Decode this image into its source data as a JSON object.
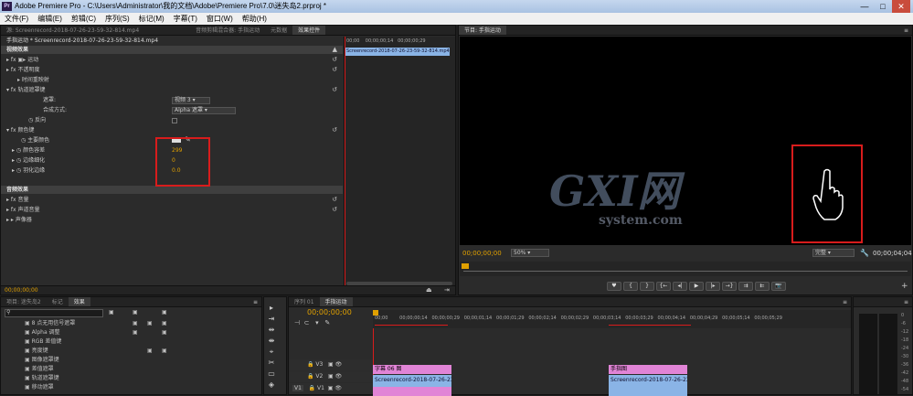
{
  "window": {
    "title": "Adobe Premiere Pro - C:\\Users\\Administrator\\我的文档\\Adobe\\Premiere Pro\\7.0\\迷失岛2.prproj *",
    "min": "—",
    "max": "□",
    "close": "✕"
  },
  "menu": [
    "文件(F)",
    "编辑(E)",
    "剪辑(C)",
    "序列(S)",
    "标记(M)",
    "字幕(T)",
    "窗口(W)",
    "帮助(H)"
  ],
  "source_tabs": [
    "源: Screenrecord-2018-07-26-23-59-32-814.mp4",
    "音频剪辑混合器: 手指运动",
    "元数据",
    "效果控件"
  ],
  "effect_controls": {
    "clip_label": "手指运动 * Screenrecord-2018-07-26-23-59-32-814.mp4",
    "timeline_ticks": [
      "00;00",
      "00;00;00;14",
      "00;00;00;29"
    ],
    "clip_name": "Screenrecord-2018-07-26-23-59-32-814.mp4",
    "video_effects_header": "视频效果",
    "motion": "fx ▣▸ 运动",
    "opacity": "fx 不透明度",
    "time_remap": "时间重映射",
    "track_matte": "fx 轨道遮罩键",
    "matte_label": "遮罩:",
    "matte_value": "视频 3",
    "composite_label": "合成方式:",
    "composite_value": "Alpha 遮罩",
    "reverse_label": "反向",
    "color_key": "fx 颜色键",
    "key_color_label": "主要颜色",
    "tolerance_label": "颜色容差",
    "tolerance_value": "299",
    "edge_thin_label": "边缘细化",
    "edge_thin_value": "0",
    "feather_label": "羽化边缘",
    "feather_value": "0.0",
    "audio_effects_header": "音频效果",
    "volume": "fx 音量",
    "channel_volume": "fx 声道音量",
    "panner": "声像器",
    "timecode": "00;00;00;00"
  },
  "program": {
    "tab": "节目: 手指运动",
    "timecode": "00;00;00;00",
    "zoom": "50%",
    "quality": "完整",
    "duration": "00;00;04;04",
    "watermark_main": "GXI网",
    "watermark_sub": "system.com"
  },
  "transport": [
    "♥",
    "{",
    "}",
    "{←",
    "◂|",
    "▶",
    "|▸",
    "→}",
    "⇉",
    "⇇",
    "📷"
  ],
  "project": {
    "tabs": [
      "项目: 迷失岛2",
      "标记",
      "效果"
    ],
    "search_placeholder": "",
    "effects": [
      "8 点无用信号遮罩",
      "Alpha 调整",
      "RGB 差值键",
      "亮度键",
      "图像遮罩键",
      "差值遮罩",
      "移除遮罩"
    ],
    "effects_more": [
      "轨道遮罩键",
      "移动遮罩"
    ]
  },
  "tools": [
    "▸",
    "⇥",
    "⇹",
    "⇼",
    "⌖",
    "◈",
    "✂",
    "▭",
    "✋",
    "🔍"
  ],
  "timeline": {
    "tabs": [
      "序列 01",
      "手指运动"
    ],
    "timecode": "00;00;00;00",
    "ruler": [
      "00;00",
      "00;00;00;14",
      "00;00;00;29",
      "00;00;01;14",
      "00;00;01;29",
      "00;00;02;14",
      "00;00;02;29",
      "00;00;03;14",
      "00;00;03;29",
      "00;00;04;14",
      "00;00;04;29",
      "00;00;05;14",
      "00;00;05;29"
    ],
    "tracks": [
      "V3",
      "V2",
      "V1"
    ],
    "title_clip_1": "字幕 06 图",
    "title_clip_2": "手指图",
    "video_clip_1": "Screenrecord-2018-07-26-23-59",
    "video_clip_2": "Screenrecord-2018-07-26-23-59"
  },
  "meter": [
    "0",
    "-6",
    "-12",
    "-18",
    "-24",
    "-30",
    "-36",
    "-42",
    "-48",
    "-54",
    "dB"
  ],
  "colors": {
    "highlight": "#d81c1c",
    "clip_pink": "#e184d6",
    "clip_blue": "#8ab4e6",
    "timecode": "#e0a000"
  }
}
